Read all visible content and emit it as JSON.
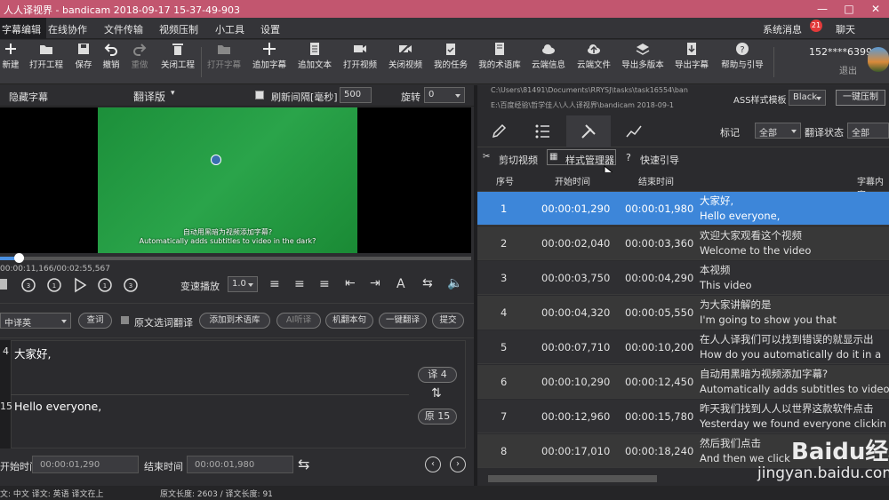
{
  "title": "人人译视界 - bandicam 2018-09-17 15-37-49-903",
  "menu": {
    "items": [
      "字幕编辑",
      "在线协作",
      "文件传输",
      "视频压制",
      "小工具",
      "设置"
    ],
    "sys_msg": "系统消息",
    "sys_badge": "21",
    "chat": "聊天"
  },
  "toolbar": {
    "items": [
      "新建",
      "打开工程",
      "保存",
      "撤销",
      "重做",
      "关闭工程",
      "打开字幕",
      "追加字幕",
      "追加文本",
      "打开视频",
      "关闭视频",
      "我的任务",
      "我的术语库",
      "云端信息",
      "云端文件",
      "导出多版本",
      "导出字幕",
      "帮助与引导"
    ],
    "user": "152****6399",
    "logout": "退出"
  },
  "video_bar": {
    "hide_sub": "隐藏字幕",
    "version": "翻译版",
    "refresh_label": "刷新间隔[毫秒]",
    "refresh_value": "500",
    "rotate_label": "旋转",
    "rotate_value": "0"
  },
  "video": {
    "sub_cn": "自动用黑暗为视频添加字幕?",
    "sub_en": "Automatically adds subtitles to video in the dark?",
    "time": "00:00:11,166/00:02:55,567",
    "progress": 0.04
  },
  "controls": {
    "speed_label": "变速播放",
    "speed_value": "1.0",
    "text_icon": "A"
  },
  "translate": {
    "lang": "中译英",
    "lookup": "查词",
    "selection": "原文选词翻译",
    "add_term": "添加到术语库",
    "ai": "AI听译",
    "machine": "机翻本句",
    "one_click": "一键翻译",
    "submit": "提交"
  },
  "editor": {
    "line1_num": "4",
    "line1_text": "大家好,",
    "line2_num": "15",
    "line2_text": "Hello everyone,",
    "trans_count": "译 4",
    "orig_count": "原 15",
    "start_label": "开始时间",
    "start_value": "00:00:01,290",
    "end_label": "结束时间",
    "end_value": "00:00:01,980"
  },
  "status": {
    "left": "文: 中文 译文: 英语 译文在上",
    "right": "原文长度: 2603 / 译文长度: 91"
  },
  "right": {
    "path1": "C:\\Users\\81491\\Documents\\RRYSJ\\tasks\\task16554\\ban",
    "path2": "E:\\百度经验\\哲学佳人\\人人译视界\\bandicam 2018-09-1",
    "ass_label": "ASS样式模板",
    "ass_value": "Black",
    "one_click_burn": "一键压制",
    "mark_label": "标记",
    "mark_value": "全部",
    "trans_state_label": "翻译状态",
    "trans_state_value": "全部",
    "sub_tabs": [
      "剪切视频",
      "样式管理器",
      "快速引导"
    ],
    "headers": [
      "序号",
      "开始时间",
      "结束时间",
      "字幕内容"
    ],
    "rows": [
      {
        "no": "1",
        "start": "00:00:01,290",
        "end": "00:00:01,980",
        "cn": "大家好,",
        "en": "Hello everyone,"
      },
      {
        "no": "2",
        "start": "00:00:02,040",
        "end": "00:00:03,360",
        "cn": "欢迎大家观看这个视频",
        "en": "Welcome to the video"
      },
      {
        "no": "3",
        "start": "00:00:03,750",
        "end": "00:00:04,290",
        "cn": "本视频",
        "en": "This video"
      },
      {
        "no": "4",
        "start": "00:00:04,320",
        "end": "00:00:05,550",
        "cn": "为大家讲解的是",
        "en": "I'm going to show you that"
      },
      {
        "no": "5",
        "start": "00:00:07,710",
        "end": "00:00:10,200",
        "cn": "在人人译我们可以找到错误的就显示出",
        "en": "How do you automatically do it in a"
      },
      {
        "no": "6",
        "start": "00:00:10,290",
        "end": "00:00:12,450",
        "cn": "自动用黑暗为视频添加字幕?",
        "en": "Automatically adds subtitles to video"
      },
      {
        "no": "7",
        "start": "00:00:12,960",
        "end": "00:00:15,780",
        "cn": "昨天我们找到人人以世界这款软件点击",
        "en": "Yesterday we found everyone clickin"
      },
      {
        "no": "8",
        "start": "00:00:17,010",
        "end": "00:00:18,240",
        "cn": "然后我们点击",
        "en": "And then we click"
      }
    ]
  },
  "watermark": {
    "brand": "Baidu经验",
    "url": "jingyan.baidu.com"
  },
  "colors": {
    "titlebar": "#c2566f",
    "selected_row": "#3d86d9",
    "video_green": "#2aa44a"
  }
}
